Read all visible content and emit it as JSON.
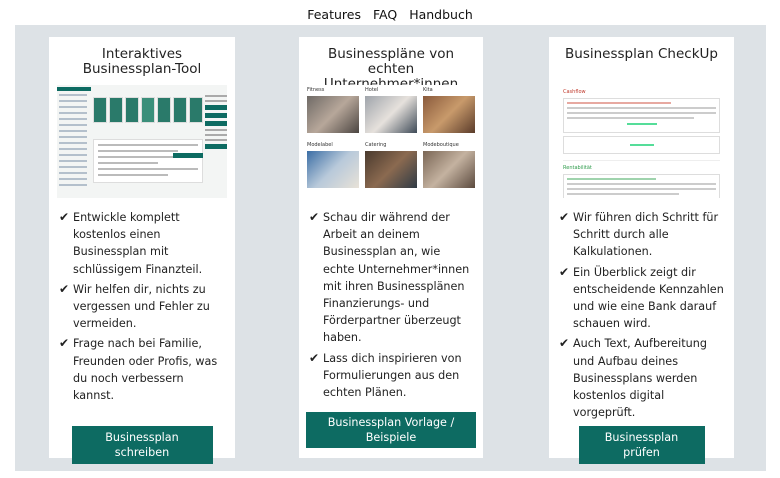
{
  "tabs": [
    {
      "label": "Features",
      "active": true
    },
    {
      "label": "FAQ",
      "active": false
    },
    {
      "label": "Handbuch",
      "active": false
    }
  ],
  "colors": {
    "accent": "#0d6b62",
    "panel_bg": "#dde2e6",
    "check_red": "#c0392b",
    "check_green": "#2e9b4b"
  },
  "cards": [
    {
      "title": "Interaktives Businessplan-Tool",
      "bullets": [
        "Entwickle komplett kostenlos einen Businessplan mit schlüssigem Finanzteil.",
        "Wir helfen dir, nichts zu vergessen und Fehler zu vermeiden.",
        "Frage nach bei Familie, Freunden oder Profis, was du noch verbessern kannst."
      ],
      "button": "Businessplan schreiben"
    },
    {
      "title": "Businesspläne von echten Unternehmer*innen",
      "photos": [
        "Fitness",
        "Hotel",
        "Kita",
        "Modelabel",
        "Catering",
        "Modeboutique"
      ],
      "bullets": [
        "Schau dir während der Arbeit an deinem Businessplan an, wie echte Unternehmer*innen mit ihren Businessplänen Finanzierungs- und Förderpartner überzeugt haben.",
        "Lass dich inspirieren von Formulierungen aus den echten Plänen."
      ],
      "button": "Businessplan Vorlage / Beispiele"
    },
    {
      "title": "Businessplan CheckUp",
      "preview": {
        "heading_1": "Cashflow",
        "heading_2": "Rentabilität"
      },
      "bullets": [
        "Wir führen dich Schritt für Schritt durch alle Kalkulationen.",
        "Ein Überblick zeigt dir entscheidende Kennzahlen und wie eine Bank darauf schauen wird.",
        "Auch Text, Aufbereitung und Aufbau deines Businessplans werden kostenlos digital vorgeprüft."
      ],
      "button": "Businessplan prüfen"
    }
  ],
  "check_glyph": "✔"
}
